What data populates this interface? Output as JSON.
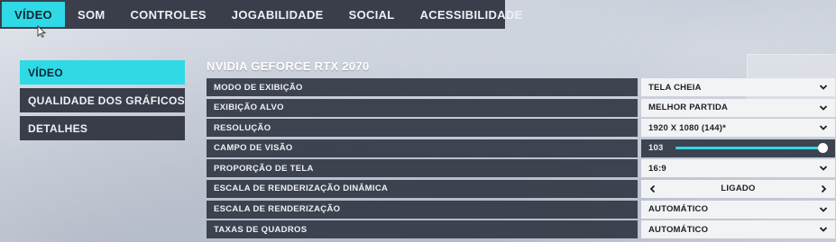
{
  "topbar": {
    "tabs": [
      {
        "label": "VÍDEO",
        "active": true
      },
      {
        "label": "SOM",
        "active": false
      },
      {
        "label": "CONTROLES",
        "active": false
      },
      {
        "label": "JOGABILIDADE",
        "active": false
      },
      {
        "label": "SOCIAL",
        "active": false
      },
      {
        "label": "ACESSIBILIDADE",
        "active": false
      }
    ]
  },
  "sidenav": {
    "items": [
      {
        "label": "VÍDEO",
        "active": true
      },
      {
        "label": "QUALIDADE DOS GRÁFICOS",
        "active": false
      },
      {
        "label": "DETALHES",
        "active": false
      }
    ]
  },
  "panel": {
    "gpu_name": "NVIDIA GEFORCE RTX 2070",
    "settings": [
      {
        "label": "MODO DE EXIBIÇÃO",
        "type": "dropdown",
        "value": "TELA CHEIA"
      },
      {
        "label": "EXIBIÇÃO ALVO",
        "type": "dropdown",
        "value": "MELHOR PARTIDA"
      },
      {
        "label": "RESOLUÇÃO",
        "type": "dropdown",
        "value": "1920 X 1080 (144)*"
      },
      {
        "label": "CAMPO DE VISÃO",
        "type": "slider",
        "value": "103",
        "fraction": 1.0
      },
      {
        "label": "PROPORÇÃO DE TELA",
        "type": "dropdown",
        "value": "16:9"
      },
      {
        "label": "ESCALA DE RENDERIZAÇÃO DINÂMICA",
        "type": "stepper",
        "value": "LIGADO"
      },
      {
        "label": "ESCALA DE RENDERIZAÇÃO",
        "type": "dropdown",
        "value": "AUTOMÁTICO"
      },
      {
        "label": "TAXAS DE QUADROS",
        "type": "dropdown",
        "value": "AUTOMÁTICO"
      }
    ]
  },
  "icons": {
    "dropdown": "chevron-down-icon",
    "stepper_left": "chevron-left-icon",
    "stepper_right": "chevron-right-icon",
    "cursor": "mouse-cursor-icon"
  },
  "colors": {
    "accent": "#2fd9e6",
    "panel_dark": "#323744",
    "control_light": "#f2f3f5"
  }
}
